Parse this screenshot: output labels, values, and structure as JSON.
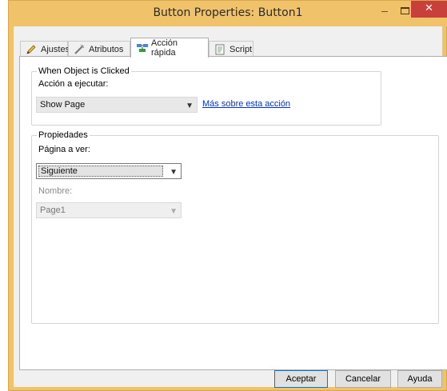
{
  "window": {
    "title": "Button Properties: Button1",
    "minimize_glyph": "–",
    "close_glyph": "✕"
  },
  "tabs": [
    {
      "label": "Ajustes",
      "icon": "pencil-icon"
    },
    {
      "label": "Atributos",
      "icon": "wand-icon"
    },
    {
      "label": "Acción rápida",
      "icon": "quick-action-icon",
      "active": true
    },
    {
      "label": "Script",
      "icon": "script-icon"
    }
  ],
  "when_clicked": {
    "legend": "When Object is Clicked",
    "action_label": "Acción a ejecutar:",
    "action_value": "Show Page",
    "more_link": "Más sobre esta acción"
  },
  "properties": {
    "legend": "Propiedades",
    "page_label": "Página a ver:",
    "page_value": "Siguiente",
    "name_label": "Nombre:",
    "name_value": "Page1"
  },
  "buttons": {
    "ok": "Aceptar",
    "cancel": "Cancelar",
    "help": "Ayuda"
  },
  "colors": {
    "titlebar": "#f0c36a",
    "close": "#c7403a",
    "link": "#0033cc"
  }
}
